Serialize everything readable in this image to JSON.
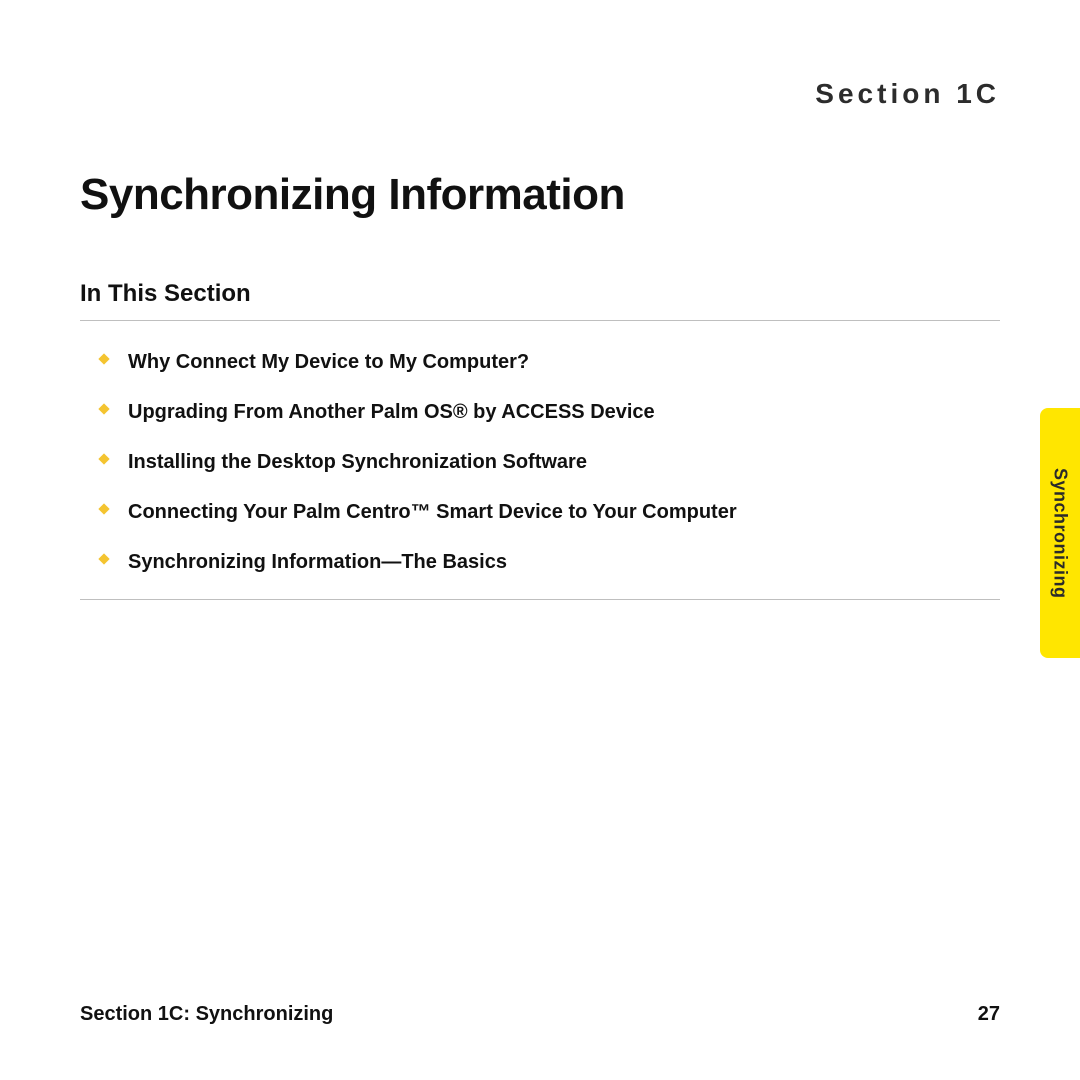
{
  "header": {
    "section_label": "Section 1C"
  },
  "title": "Synchronizing Information",
  "subhead": "In This Section",
  "items": [
    "Why Connect My Device to My Computer?",
    "Upgrading From Another Palm OS® by ACCESS Device",
    "Installing the Desktop Synchronization Software",
    "Connecting Your Palm Centro™ Smart Device to Your Computer",
    "Synchronizing Information—The Basics"
  ],
  "side_tab": "Synchronizing",
  "footer": {
    "left": "Section 1C: Synchronizing",
    "right": "27"
  }
}
